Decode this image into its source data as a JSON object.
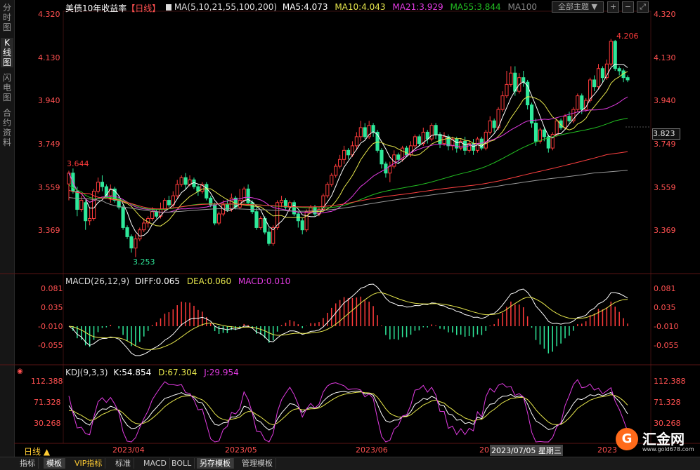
{
  "sidebar": {
    "tabs": [
      "分时图",
      "K线图",
      "闪电图",
      "合约资料"
    ],
    "active": 1
  },
  "header": {
    "title": "美债10年收益率",
    "period": "【日线】",
    "ma_label": "MA(5,10,21,55,100,200)",
    "ma5": "MA5:4.073",
    "ma10": "MA10:4.043",
    "ma21": "MA21:3.929",
    "ma55": "MA55:3.844",
    "ma100": "MA100",
    "theme_select": "全部主题"
  },
  "colors": {
    "up": "#ff3b3b",
    "down": "#2ee89a",
    "ma5": "#ffffff",
    "ma10": "#e6e64c",
    "ma21": "#e23be2",
    "ma55": "#22c022",
    "ma100": "#ff4040",
    "ma200": "#9a9a9a"
  },
  "price_axis": {
    "ticks": [
      "4.320",
      "4.130",
      "3.940",
      "3.749",
      "3.559",
      "3.369"
    ],
    "current": "3.823"
  },
  "annotations": {
    "high": "4.206",
    "low": "3.253",
    "start": "3.644"
  },
  "macd": {
    "label": "MACD(26,12,9)",
    "diff": "DIFF:0.065",
    "dea": "DEA:0.060",
    "macd": "MACD:0.010",
    "ticks": [
      "0.081",
      "0.035",
      "-0.010",
      "-0.055"
    ]
  },
  "kdj": {
    "label": "KDJ(9,3,3)",
    "k": "K:54.854",
    "d": "D:67.304",
    "j": "J:29.954",
    "ticks": [
      "112.388",
      "71.328",
      "30.268"
    ]
  },
  "time_axis": {
    "period_btn": "日线 ▲",
    "labels": [
      "2023/04",
      "2023/05",
      "2023/06",
      "20",
      "2023/07/05 星期三",
      "2023"
    ]
  },
  "bottom_tabs": [
    "指标",
    "模板",
    "VIP指标",
    "标准",
    "MACD",
    "BOLL",
    "另存模板",
    "管理模板"
  ],
  "logo": {
    "text": "汇金网",
    "url": "www.gold678.com"
  },
  "chart_data": {
    "type": "candlestick",
    "price_range": [
      3.25,
      4.32
    ],
    "candles": [
      [
        3.572,
        3.62,
        3.63,
        3.5
      ],
      [
        3.62,
        3.54,
        3.64,
        3.53
      ],
      [
        3.54,
        3.46,
        3.56,
        3.43
      ],
      [
        3.46,
        3.5,
        3.52,
        3.45
      ],
      [
        3.49,
        3.41,
        3.5,
        3.37
      ],
      [
        3.41,
        3.42,
        3.47,
        3.39
      ],
      [
        3.42,
        3.54,
        3.55,
        3.41
      ],
      [
        3.54,
        3.58,
        3.6,
        3.53
      ],
      [
        3.58,
        3.56,
        3.61,
        3.54
      ],
      [
        3.56,
        3.52,
        3.57,
        3.51
      ],
      [
        3.52,
        3.55,
        3.57,
        3.49
      ],
      [
        3.55,
        3.5,
        3.56,
        3.49
      ],
      [
        3.5,
        3.47,
        3.52,
        3.46
      ],
      [
        3.47,
        3.38,
        3.48,
        3.37
      ],
      [
        3.38,
        3.34,
        3.39,
        3.33
      ],
      [
        3.34,
        3.29,
        3.35,
        3.27
      ],
      [
        3.29,
        3.33,
        3.35,
        3.25
      ],
      [
        3.33,
        3.37,
        3.38,
        3.32
      ],
      [
        3.37,
        3.4,
        3.42,
        3.36
      ],
      [
        3.4,
        3.42,
        3.43,
        3.38
      ],
      [
        3.42,
        3.45,
        3.47,
        3.41
      ],
      [
        3.45,
        3.43,
        3.46,
        3.42
      ],
      [
        3.43,
        3.46,
        3.49,
        3.42
      ],
      [
        3.46,
        3.5,
        3.51,
        3.45
      ],
      [
        3.5,
        3.48,
        3.52,
        3.47
      ],
      [
        3.48,
        3.52,
        3.54,
        3.47
      ],
      [
        3.52,
        3.57,
        3.59,
        3.51
      ],
      [
        3.57,
        3.6,
        3.61,
        3.56
      ],
      [
        3.6,
        3.57,
        3.62,
        3.55
      ],
      [
        3.57,
        3.59,
        3.61,
        3.56
      ],
      [
        3.59,
        3.56,
        3.6,
        3.55
      ],
      [
        3.56,
        3.54,
        3.57,
        3.52
      ],
      [
        3.54,
        3.57,
        3.58,
        3.53
      ],
      [
        3.57,
        3.51,
        3.58,
        3.5
      ],
      [
        3.51,
        3.48,
        3.52,
        3.47
      ],
      [
        3.48,
        3.4,
        3.49,
        3.39
      ],
      [
        3.4,
        3.44,
        3.45,
        3.39
      ],
      [
        3.44,
        3.48,
        3.5,
        3.43
      ],
      [
        3.48,
        3.46,
        3.5,
        3.45
      ],
      [
        3.46,
        3.51,
        3.53,
        3.45
      ],
      [
        3.51,
        3.47,
        3.52,
        3.46
      ],
      [
        3.47,
        3.5,
        3.55,
        3.46
      ],
      [
        3.5,
        3.55,
        3.56,
        3.49
      ],
      [
        3.55,
        3.49,
        3.57,
        3.48
      ],
      [
        3.49,
        3.45,
        3.5,
        3.44
      ],
      [
        3.45,
        3.38,
        3.47,
        3.37
      ],
      [
        3.38,
        3.42,
        3.43,
        3.37
      ],
      [
        3.42,
        3.36,
        3.43,
        3.35
      ],
      [
        3.36,
        3.31,
        3.38,
        3.3
      ],
      [
        3.31,
        3.38,
        3.39,
        3.3
      ],
      [
        3.38,
        3.49,
        3.5,
        3.37
      ],
      [
        3.49,
        3.5,
        3.52,
        3.47
      ],
      [
        3.5,
        3.47,
        3.51,
        3.46
      ],
      [
        3.47,
        3.49,
        3.5,
        3.45
      ],
      [
        3.49,
        3.44,
        3.5,
        3.43
      ],
      [
        3.44,
        3.41,
        3.45,
        3.38
      ],
      [
        3.41,
        3.37,
        3.42,
        3.35
      ],
      [
        3.37,
        3.45,
        3.46,
        3.36
      ],
      [
        3.45,
        3.47,
        3.48,
        3.44
      ],
      [
        3.47,
        3.44,
        3.48,
        3.43
      ],
      [
        3.44,
        3.46,
        3.47,
        3.43
      ],
      [
        3.46,
        3.52,
        3.53,
        3.45
      ],
      [
        3.52,
        3.57,
        3.58,
        3.51
      ],
      [
        3.57,
        3.61,
        3.62,
        3.56
      ],
      [
        3.61,
        3.65,
        3.66,
        3.6
      ],
      [
        3.65,
        3.68,
        3.7,
        3.64
      ],
      [
        3.68,
        3.72,
        3.74,
        3.66
      ],
      [
        3.72,
        3.7,
        3.73,
        3.68
      ],
      [
        3.7,
        3.74,
        3.76,
        3.69
      ],
      [
        3.74,
        3.78,
        3.8,
        3.72
      ],
      [
        3.78,
        3.82,
        3.85,
        3.76
      ],
      [
        3.82,
        3.78,
        3.84,
        3.77
      ],
      [
        3.78,
        3.83,
        3.85,
        3.77
      ],
      [
        3.83,
        3.8,
        3.84,
        3.78
      ],
      [
        3.8,
        3.72,
        3.81,
        3.71
      ],
      [
        3.72,
        3.66,
        3.73,
        3.64
      ],
      [
        3.66,
        3.62,
        3.67,
        3.6
      ],
      [
        3.62,
        3.65,
        3.67,
        3.58
      ],
      [
        3.65,
        3.7,
        3.72,
        3.64
      ],
      [
        3.7,
        3.68,
        3.71,
        3.66
      ],
      [
        3.68,
        3.73,
        3.74,
        3.67
      ],
      [
        3.73,
        3.7,
        3.74,
        3.69
      ],
      [
        3.7,
        3.74,
        3.76,
        3.69
      ],
      [
        3.74,
        3.78,
        3.79,
        3.73
      ],
      [
        3.78,
        3.75,
        3.79,
        3.74
      ],
      [
        3.75,
        3.8,
        3.82,
        3.74
      ],
      [
        3.8,
        3.77,
        3.81,
        3.75
      ],
      [
        3.77,
        3.83,
        3.84,
        3.76
      ],
      [
        3.83,
        3.79,
        3.84,
        3.77
      ],
      [
        3.79,
        3.75,
        3.8,
        3.73
      ],
      [
        3.75,
        3.78,
        3.8,
        3.74
      ],
      [
        3.78,
        3.74,
        3.79,
        3.72
      ],
      [
        3.74,
        3.77,
        3.78,
        3.72
      ],
      [
        3.77,
        3.73,
        3.78,
        3.71
      ],
      [
        3.73,
        3.76,
        3.77,
        3.72
      ],
      [
        3.76,
        3.72,
        3.78,
        3.7
      ],
      [
        3.72,
        3.75,
        3.76,
        3.71
      ],
      [
        3.75,
        3.72,
        3.77,
        3.7
      ],
      [
        3.72,
        3.77,
        3.78,
        3.71
      ],
      [
        3.77,
        3.73,
        3.78,
        3.72
      ],
      [
        3.73,
        3.8,
        3.81,
        3.72
      ],
      [
        3.8,
        3.85,
        3.87,
        3.79
      ],
      [
        3.85,
        3.82,
        3.86,
        3.8
      ],
      [
        3.82,
        3.9,
        3.91,
        3.81
      ],
      [
        3.9,
        3.96,
        3.98,
        3.89
      ],
      [
        3.96,
        4.01,
        4.07,
        3.95
      ],
      [
        4.01,
        4.06,
        4.09,
        4.0
      ],
      [
        4.06,
        3.98,
        4.09,
        3.96
      ],
      [
        3.98,
        4.04,
        4.06,
        3.97
      ],
      [
        4.04,
        4.02,
        4.07,
        4.0
      ],
      [
        4.02,
        3.92,
        4.03,
        3.9
      ],
      [
        3.92,
        3.84,
        3.93,
        3.82
      ],
      [
        3.84,
        3.76,
        3.86,
        3.74
      ],
      [
        3.76,
        3.81,
        3.82,
        3.75
      ],
      [
        3.81,
        3.78,
        3.82,
        3.76
      ],
      [
        3.78,
        3.73,
        3.79,
        3.71
      ],
      [
        3.73,
        3.79,
        3.8,
        3.72
      ],
      [
        3.79,
        3.85,
        3.86,
        3.78
      ],
      [
        3.85,
        3.82,
        3.86,
        3.81
      ],
      [
        3.82,
        3.87,
        3.88,
        3.81
      ],
      [
        3.87,
        3.85,
        3.89,
        3.84
      ],
      [
        3.85,
        3.9,
        3.91,
        3.84
      ],
      [
        3.9,
        3.96,
        3.97,
        3.89
      ],
      [
        3.96,
        3.9,
        3.97,
        3.88
      ],
      [
        3.9,
        3.94,
        3.95,
        3.89
      ],
      [
        3.94,
        4.03,
        4.04,
        3.93
      ],
      [
        4.03,
        4.0,
        4.05,
        3.98
      ],
      [
        4.0,
        4.08,
        4.1,
        3.99
      ],
      [
        4.08,
        4.04,
        4.09,
        4.02
      ],
      [
        4.04,
        4.1,
        4.12,
        4.03
      ],
      [
        4.1,
        4.2,
        4.21,
        4.09
      ],
      [
        4.2,
        4.08,
        4.206,
        4.07
      ],
      [
        4.08,
        4.07,
        4.09,
        4.05
      ],
      [
        4.07,
        4.04,
        4.08,
        4.02
      ],
      [
        4.04,
        4.03,
        4.05,
        4.02
      ]
    ]
  }
}
